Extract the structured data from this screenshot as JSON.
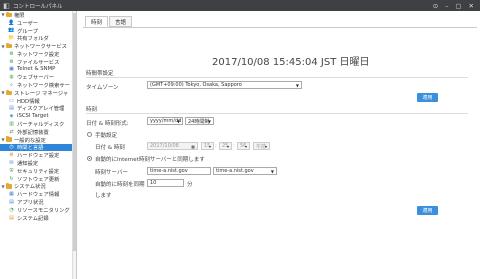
{
  "window": {
    "app_name": "コントロールパネル"
  },
  "sidebar": {
    "items": [
      {
        "label": "権限",
        "level": 0,
        "type": "folder",
        "expanded": true
      },
      {
        "label": "ユーザー",
        "level": 1,
        "type": "user-icon"
      },
      {
        "label": "グループ",
        "level": 1,
        "type": "group-icon"
      },
      {
        "label": "共有フォルダ",
        "level": 1,
        "type": "shared-folder-icon"
      },
      {
        "label": "ネットワークサービス",
        "level": 0,
        "type": "folder",
        "expanded": true
      },
      {
        "label": "ネットワーク設定",
        "level": 1,
        "type": "network-icon"
      },
      {
        "label": "ファイルサービス",
        "level": 1,
        "type": "file-service-icon"
      },
      {
        "label": "Telnet & SNMP",
        "level": 1,
        "type": "telnet-icon"
      },
      {
        "label": "ウェブサーバー",
        "level": 1,
        "type": "web-icon"
      },
      {
        "label": "ネットワーク検索サー",
        "level": 1,
        "type": "search-icon"
      },
      {
        "label": "ストレージ マネージャ",
        "level": 0,
        "type": "folder",
        "expanded": true
      },
      {
        "label": "HDD情報",
        "level": 1,
        "type": "hdd-icon"
      },
      {
        "label": "ディスクアレイ管理",
        "level": 1,
        "type": "raid-icon"
      },
      {
        "label": "iSCSI Target",
        "level": 1,
        "type": "iscsi-icon"
      },
      {
        "label": "バーチャルディスク",
        "level": 1,
        "type": "virtual-disk-icon"
      },
      {
        "label": "外部記憶装置",
        "level": 1,
        "type": "external-icon"
      },
      {
        "label": "一般的な設定",
        "level": 0,
        "type": "folder",
        "expanded": true
      },
      {
        "label": "時間と言語",
        "level": 1,
        "type": "clock-icon",
        "selected": true
      },
      {
        "label": "ハードウェア設定",
        "level": 1,
        "type": "hardware-icon"
      },
      {
        "label": "通知設定",
        "level": 1,
        "type": "notification-icon"
      },
      {
        "label": "セキュリティ設定",
        "level": 1,
        "type": "security-icon"
      },
      {
        "label": "ソフトウェア更新",
        "level": 1,
        "type": "update-icon"
      },
      {
        "label": "システム状況",
        "level": 0,
        "type": "folder",
        "expanded": true
      },
      {
        "label": "ハードウェア情報",
        "level": 1,
        "type": "hw-info-icon"
      },
      {
        "label": "アプリ状況",
        "level": 1,
        "type": "app-status-icon"
      },
      {
        "label": "リソースモニタリング",
        "level": 1,
        "type": "monitor-icon"
      },
      {
        "label": "システム記録",
        "level": 1,
        "type": "log-icon"
      }
    ]
  },
  "tabs": [
    {
      "label": "時刻",
      "active": true
    },
    {
      "label": "言語",
      "active": false
    }
  ],
  "clock": {
    "text": "2017/10/08 15:45:04 JST 日曜日"
  },
  "timezone_section": {
    "title": "時間帯設定",
    "label": "タイムゾーン",
    "value": "(GMT+09:00) Tokyo, Osaka, Sapporo",
    "apply": "適用"
  },
  "time_section": {
    "title": "時刻",
    "format_label": "日付 & 時刻形式:",
    "date_format": "yyyy/mm/dd",
    "time_format": "24時間制",
    "manual_label": "手動設定",
    "datetime_label": "日付 & 時刻",
    "date_value": "2017/10/08",
    "hour": "15",
    "minute": "25",
    "second": "56",
    "ampm": "午前",
    "auto_label": "自動的にInternet時刻サーバーと同期します",
    "server_label": "時刻サーバー",
    "server_value": "time-a.nist.gov",
    "server_select": "time-a.nist.gov",
    "interval_label": "自動的に時刻を同期",
    "interval_label2": "します",
    "interval_value": "10",
    "interval_unit": "分",
    "apply": "適用"
  },
  "colors": {
    "accent": "#3b8fdc",
    "titlebar": "#3e4043",
    "selected": "#2f86d9"
  }
}
